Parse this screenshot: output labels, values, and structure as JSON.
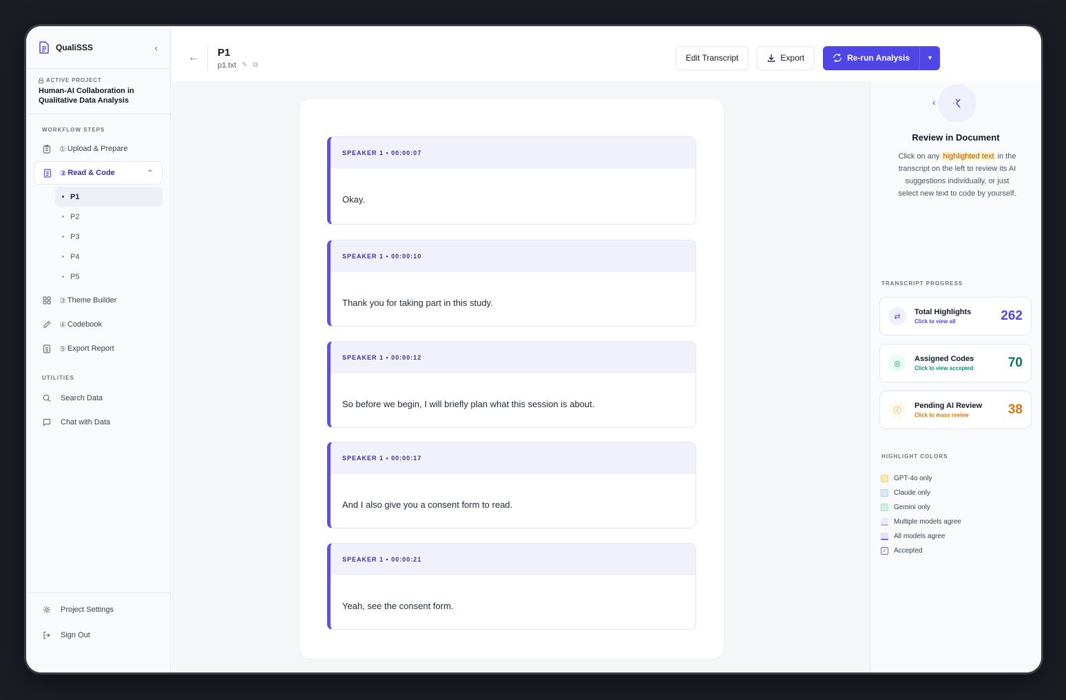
{
  "sidebar": {
    "app_name": "QualiSSS",
    "project_label": "ACTIVE PROJECT",
    "project_title": "Human-AI Collaboration in Qualitative Data Analysis",
    "workflow_label": "WORKFLOW STEPS",
    "steps": [
      {
        "num": "①",
        "label": "Upload & Prepare"
      },
      {
        "num": "②",
        "label": "Read & Code"
      },
      {
        "num": "③",
        "label": "Theme Builder"
      },
      {
        "num": "④",
        "label": "Codebook"
      },
      {
        "num": "⑤",
        "label": "Export Report"
      }
    ],
    "subitems": [
      "P1",
      "P2",
      "P3",
      "P4",
      "P5"
    ],
    "utilities_label": "UTILITIES",
    "utilities": [
      "Search Data",
      "Chat with Data"
    ],
    "bottom": [
      "Project Settings",
      "Sign Out"
    ]
  },
  "header": {
    "title": "P1",
    "file": "p1.txt",
    "edit_transcript": "Edit Transcript",
    "export": "Export",
    "rerun": "Re-run Analysis"
  },
  "segments": [
    {
      "speaker": "SPEAKER 1 • 00:00:07",
      "text": "Okay."
    },
    {
      "speaker": "SPEAKER 1 • 00:00:10",
      "text": "Thank you for taking part in this study."
    },
    {
      "speaker": "SPEAKER 1 • 00:00:12",
      "text": "So before we begin, I will briefly plan what this session is about."
    },
    {
      "speaker": "SPEAKER 1 • 00:00:17",
      "text": "And I also give you a consent form to read."
    },
    {
      "speaker": "SPEAKER 1 • 00:00:21",
      "text": "Yeah, see the consent form."
    }
  ],
  "right_panel": {
    "review_title": "Review in Document",
    "review_pre": "Click on any",
    "review_highlight": "highlighted text",
    "review_post": "in the transcript on the left to review its AI suggestions individually, or just select new text to code by yourself.",
    "progress_label": "TRANSCRIPT PROGRESS",
    "stats": [
      {
        "title": "Total Highlights",
        "sub": "Click to view all",
        "value": "262",
        "color": "#4f46e5",
        "bg": "#eef0fb"
      },
      {
        "title": "Assigned Codes",
        "sub": "Click to view accepted",
        "value": "70",
        "color": "#047857",
        "bg": "#ecfdf5"
      },
      {
        "title": "Pending AI Review",
        "sub": "Click to mass review",
        "value": "38",
        "color": "#d97706",
        "bg": "#fffbeb"
      }
    ],
    "colors_label": "HIGHLIGHT COLORS",
    "legend": [
      {
        "label": "GPT-4o only",
        "color": "#fde9a6"
      },
      {
        "label": "Claude only",
        "color": "#dbe7fb"
      },
      {
        "label": "Gemini only",
        "color": "#ccf2df"
      },
      {
        "label": "Multiple models agree",
        "color": "#ede9fb"
      },
      {
        "label": "All models agree",
        "color": "#e4e1fa"
      },
      {
        "label": "Accepted",
        "color": "#ffffff"
      }
    ]
  }
}
